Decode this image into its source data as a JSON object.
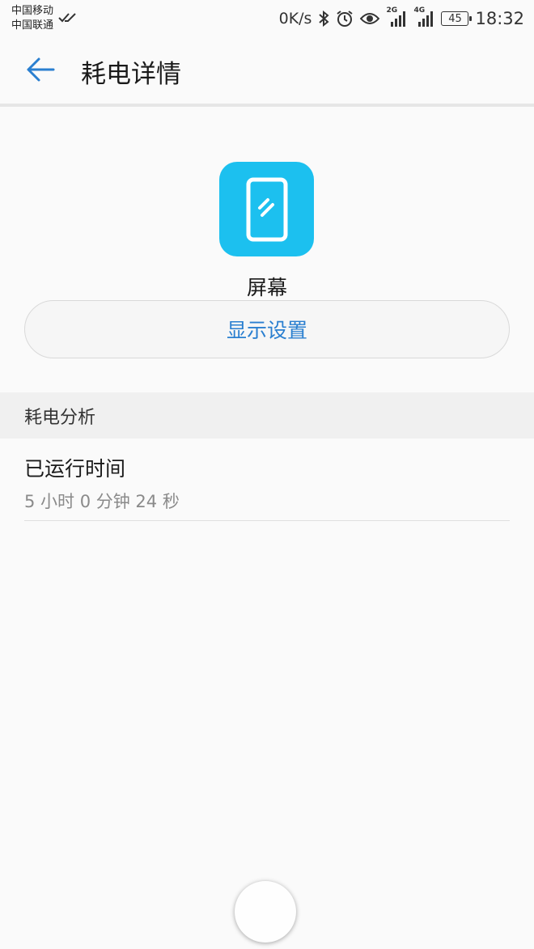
{
  "status_bar": {
    "carrier_1": "中国移动",
    "carrier_2": "中国联通",
    "net_speed": "0K/s",
    "signal_1_label": "2G",
    "signal_2_label": "4G",
    "battery": "45",
    "time": "18:32"
  },
  "header": {
    "title": "耗电详情"
  },
  "app": {
    "name": "屏幕",
    "icon_color": "#1cc0ef",
    "settings_button_label": "显示设置"
  },
  "section": {
    "title": "耗电分析",
    "items": [
      {
        "label": "已运行时间",
        "value": "5 小时 0 分钟 24 秒"
      }
    ]
  },
  "colors": {
    "accent": "#2a7fd0",
    "back_arrow": "#2a7fd0"
  }
}
